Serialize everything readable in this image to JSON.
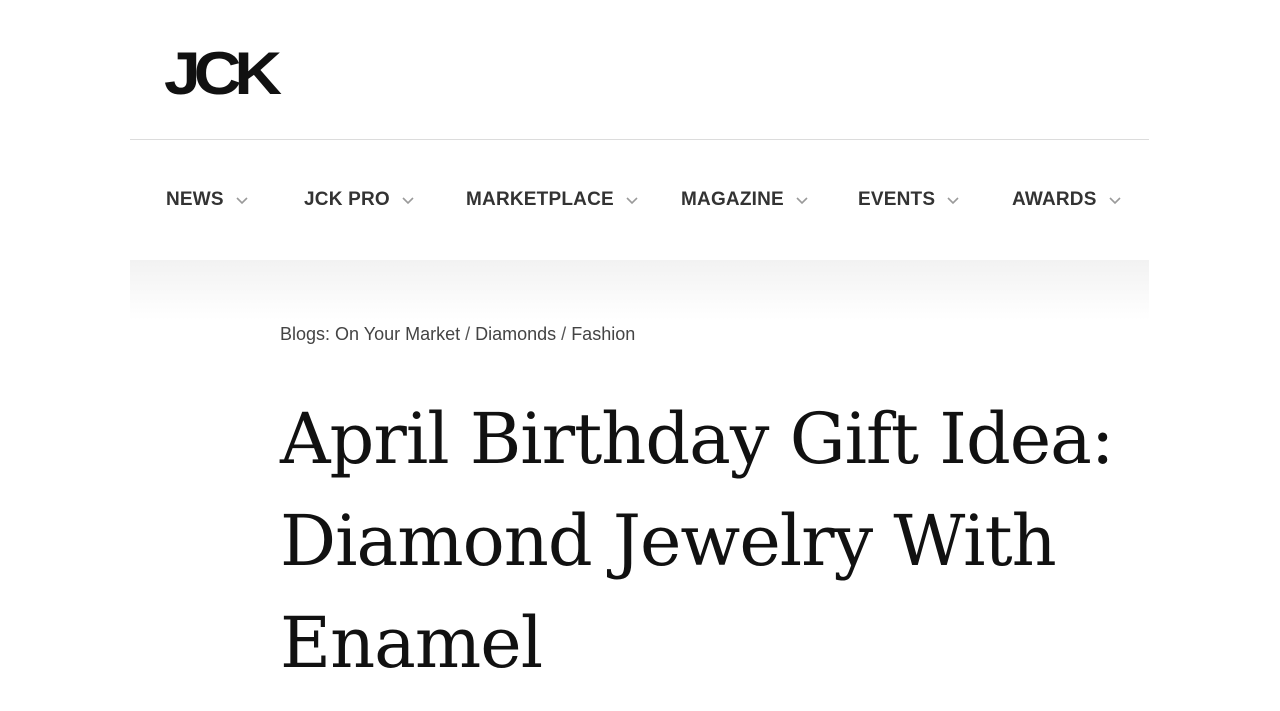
{
  "site": {
    "logo_text": "JCK"
  },
  "nav": {
    "items": [
      {
        "label": "NEWS"
      },
      {
        "label": "JCK PRO"
      },
      {
        "label": "MARKETPLACE"
      },
      {
        "label": "MAGAZINE"
      },
      {
        "label": "EVENTS"
      },
      {
        "label": "AWARDS"
      }
    ],
    "chevron_icon": "chevron-down-icon"
  },
  "breadcrumb": {
    "items": [
      "Blogs: On Your Market",
      "Diamonds",
      "Fashion"
    ],
    "separator": "/"
  },
  "article": {
    "title": "April Birthday Gift Idea: Diamond Jewelry With Enamel"
  },
  "colors": {
    "text": "#111111",
    "nav_text": "#333333",
    "divider": "#dcdcdc"
  }
}
